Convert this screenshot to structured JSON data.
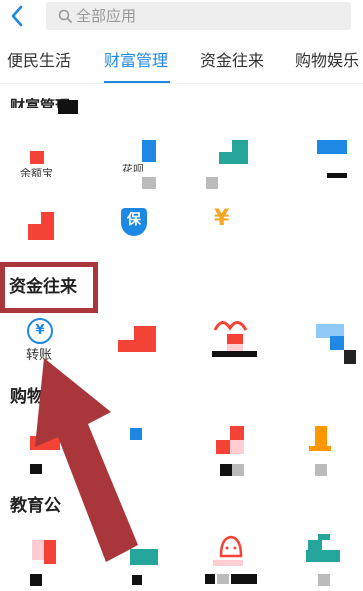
{
  "search": {
    "placeholder": "全部应用"
  },
  "tabs": [
    "便民生活",
    "财富管理",
    "资金往来",
    "购物娱乐"
  ],
  "sections": {
    "wealth_fragment": "财富管理",
    "funds": "资金往来",
    "shopping_fragment": "购物",
    "education_fragment": "教育公"
  },
  "apps": {
    "yuebao_fragment": "余额宝",
    "huabei_fragment": "花呗",
    "transfer": "转账"
  },
  "icons": {
    "back": "chevron-left-icon",
    "search": "search-icon",
    "transfer": "transfer-icon",
    "insurance": "insurance-icon",
    "fund": "yen-icon",
    "annotation": "red-arrow-icon"
  },
  "colors": {
    "accent": "#1e88e5",
    "highlight": "#a8363a",
    "arrow": "#a8363a"
  }
}
